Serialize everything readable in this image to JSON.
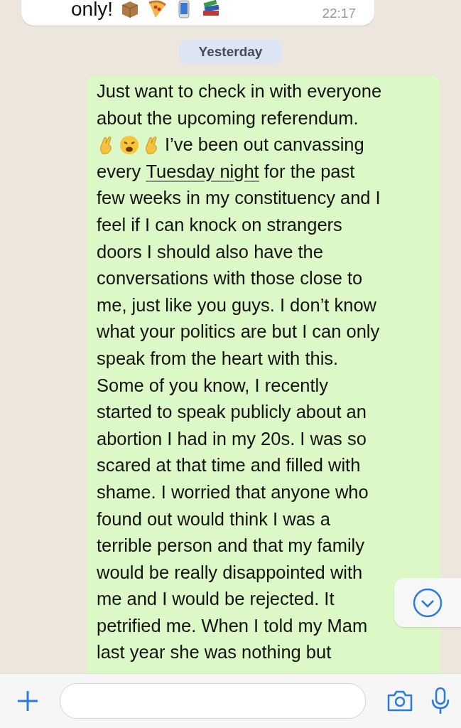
{
  "previous_message": {
    "segments": [
      {
        "kind": "text",
        "text": "only!"
      },
      {
        "kind": "box-icon"
      },
      {
        "kind": "pizza-icon"
      },
      {
        "kind": "phone-icon"
      },
      {
        "kind": "books-icon"
      }
    ],
    "time": "22:17"
  },
  "date_divider": "Yesterday",
  "message": {
    "lines": [
      {
        "segments": [
          {
            "kind": "text",
            "text": "Just want to check in with everyone"
          }
        ]
      },
      {
        "segments": [
          {
            "kind": "text",
            "text": "about the upcoming referendum."
          }
        ]
      },
      {
        "segments": [
          {
            "kind": "fingers-icon"
          },
          {
            "kind": "face-icon"
          },
          {
            "kind": "fingers-icon"
          },
          {
            "kind": "text",
            "text": "I’ve been out canvassing"
          }
        ]
      },
      {
        "segments": [
          {
            "kind": "text",
            "text": "every "
          },
          {
            "kind": "link",
            "text": "Tuesday night"
          },
          {
            "kind": "text",
            "text": " for the past"
          }
        ]
      },
      {
        "segments": [
          {
            "kind": "text",
            "text": "few weeks in my constituency and I"
          }
        ]
      },
      {
        "segments": [
          {
            "kind": "text",
            "text": "feel if I can knock on strangers"
          }
        ]
      },
      {
        "segments": [
          {
            "kind": "text",
            "text": "doors I should also have the"
          }
        ]
      },
      {
        "segments": [
          {
            "kind": "text",
            "text": "conversations with those close to"
          }
        ]
      },
      {
        "segments": [
          {
            "kind": "text",
            "text": "me, just like you guys. I don’t know"
          }
        ]
      },
      {
        "segments": [
          {
            "kind": "text",
            "text": "what your politics are but I can only"
          }
        ]
      },
      {
        "segments": [
          {
            "kind": "text",
            "text": "speak from the heart with this."
          }
        ]
      },
      {
        "segments": [
          {
            "kind": "text",
            "text": "Some of you know, I recently"
          }
        ]
      },
      {
        "segments": [
          {
            "kind": "text",
            "text": "started to speak publicly about an"
          }
        ]
      },
      {
        "segments": [
          {
            "kind": "text",
            "text": "abortion I had in my 20s. I was so"
          }
        ]
      },
      {
        "segments": [
          {
            "kind": "text",
            "text": "scared at that time and filled with"
          }
        ]
      },
      {
        "segments": [
          {
            "kind": "text",
            "text": "shame. I worried that anyone who"
          }
        ]
      },
      {
        "segments": [
          {
            "kind": "text",
            "text": "found out would think I was a"
          }
        ]
      },
      {
        "segments": [
          {
            "kind": "text",
            "text": "terrible person and that my family"
          }
        ]
      },
      {
        "segments": [
          {
            "kind": "text",
            "text": "would be really disappointed with"
          }
        ]
      },
      {
        "segments": [
          {
            "kind": "text",
            "text": "me and I would be rejected. It"
          }
        ]
      },
      {
        "segments": [
          {
            "kind": "text",
            "text": "petrified me. When I told my Mam"
          }
        ]
      },
      {
        "segments": [
          {
            "kind": "text",
            "text": "last year she was nothing but"
          }
        ]
      }
    ]
  }
}
